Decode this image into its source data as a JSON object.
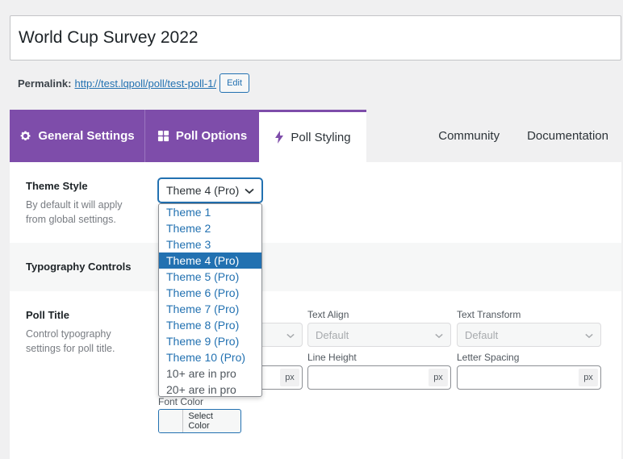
{
  "post": {
    "title": "World Cup Survey 2022",
    "permalink_label": "Permalink:",
    "permalink_url": "http://test.lqpoll/poll/test-poll-1/",
    "edit_label": "Edit"
  },
  "tabs": {
    "general": "General Settings",
    "options": "Poll Options",
    "styling": "Poll Styling",
    "community": "Community",
    "documentation": "Documentation"
  },
  "theme_style": {
    "label": "Theme Style",
    "description_line1": "By default it will apply",
    "description_line2": "from global settings.",
    "selected": "Theme 4 (Pro)",
    "options": [
      "Theme 1",
      "Theme 2",
      "Theme 3",
      "Theme 4 (Pro)",
      "Theme 5 (Pro)",
      "Theme 6 (Pro)",
      "Theme 7 (Pro)",
      "Theme 8 (Pro)",
      "Theme 9 (Pro)",
      "Theme 10 (Pro)",
      "10+ are in pro",
      "20+ are in pro"
    ]
  },
  "typography": {
    "heading": "Typography Controls"
  },
  "poll_title": {
    "label": "Poll Title",
    "description_line1": "Control typography",
    "description_line2": "settings for poll title.",
    "text_align_label": "Text Align",
    "text_align_value": "Default",
    "text_transform_label": "Text Transform",
    "text_transform_value": "Default",
    "line_height_label": "Line Height",
    "letter_spacing_label": "Letter Spacing",
    "unit": "px",
    "font_color_label": "Font Color",
    "select_color_label": "Select Color"
  },
  "colors": {
    "accent": "#7e4daa",
    "link": "#2271b1"
  }
}
